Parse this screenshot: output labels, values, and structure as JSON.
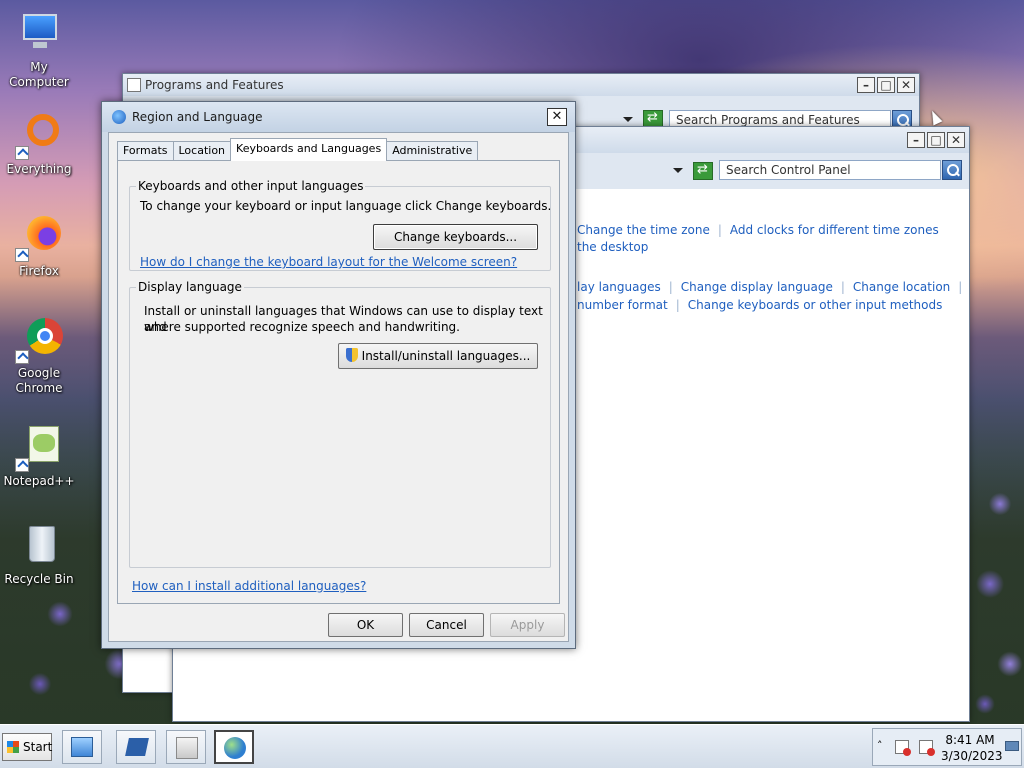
{
  "desktop": {
    "icons": [
      {
        "label": "My Computer"
      },
      {
        "label": "Everything"
      },
      {
        "label": "Firefox"
      },
      {
        "label": "Google Chrome"
      },
      {
        "label": "Notepad++"
      },
      {
        "label": "Recycle Bin"
      }
    ]
  },
  "programs_window": {
    "title": "Programs and Features",
    "search_placeholder": "Search Programs and Features"
  },
  "control_panel_window": {
    "search_placeholder": "Search Control Panel",
    "links_row1": [
      "Change the time zone",
      "Add clocks for different time zones"
    ],
    "links_row1b": "the desktop",
    "links_row2": [
      "lay languages",
      "Change display language",
      "Change location"
    ],
    "links_row3": [
      "number format",
      "Change keyboards or other input methods"
    ]
  },
  "dialog": {
    "title": "Region and Language",
    "tabs": [
      "Formats",
      "Location",
      "Keyboards and Languages",
      "Administrative"
    ],
    "active_tab": "Keyboards and Languages",
    "keyboards_group": {
      "legend": "Keyboards and other input languages",
      "text": "To change your keyboard or input language click Change keyboards.",
      "button": "Change keyboards...",
      "link": "How do I change the keyboard layout for the Welcome screen?"
    },
    "display_group": {
      "legend": "Display language",
      "text_line1": "Install or uninstall languages that Windows can use to display text and",
      "text_line2": "where supported recognize speech and handwriting.",
      "button": "Install/uninstall languages..."
    },
    "footer_link": "How can I install additional languages?",
    "buttons": {
      "ok": "OK",
      "cancel": "Cancel",
      "apply": "Apply"
    }
  },
  "taskbar": {
    "start_label": "Start",
    "clock_time": "8:41 AM",
    "clock_date": "3/30/2023"
  },
  "colors": {
    "link": "#1f5fbf",
    "dialog_frame": "#cfdbe8",
    "taskbar": "#dde5ee"
  }
}
